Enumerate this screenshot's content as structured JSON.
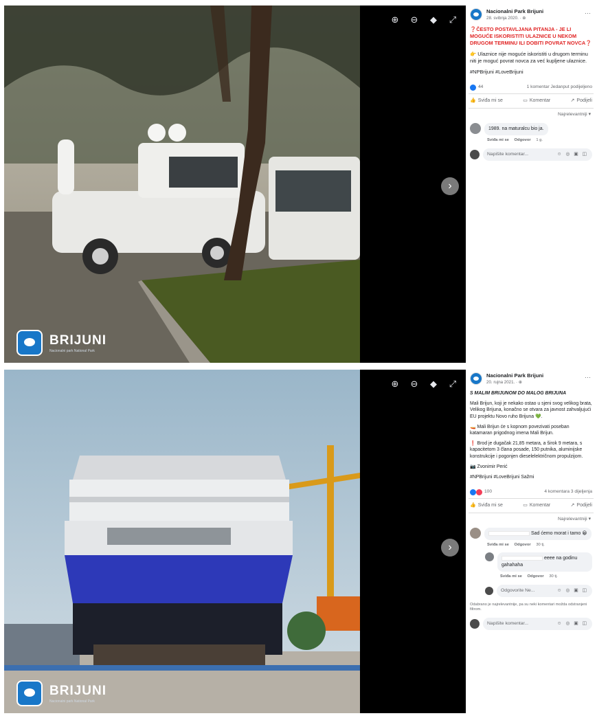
{
  "posts": [
    {
      "page_name": "Nacionalni Park Brijuni",
      "date": "28. svibnja 2020. · ⊕",
      "body": [
        "❓ČESTO POSTAVLJANA PITANJA - JE LI MOGUĆE ISKORISTITI ULAZNICE U NEKOM DRUGOM TERMINU ILI DOBITI POVRAT NOVCA❓",
        "👉 Ulaznice nije moguće iskoristiti u drugom terminu niti je moguć povrat novca za već kupljene ulaznice.",
        "#NPBrijuni #LoveBrijuni"
      ],
      "reaction_count": "44",
      "comment_share": "1 komentar Jedanput podijeljeno",
      "actions": [
        "Sviđa mi se",
        "Komentar",
        "Podijeli"
      ],
      "sort_label": "Najrelevantniji ▾",
      "comments": [
        {
          "text": "1989. na maturalcu bio ja.",
          "meta_like": "Sviđa mi se",
          "meta_reply": "Odgovor",
          "meta_time": "1 g."
        }
      ],
      "write_placeholder": "Napišite komentar...",
      "write_icons": "☺ ◎ ▣ ◫"
    },
    {
      "page_name": "Nacionalni Park Brijuni",
      "date": "20. rujna 2021. · ⊕",
      "title": "S MALIM BRIJUNOM DO MALOG BRIJUNA",
      "body": [
        "Mali Brijun, koji je nekako ostao u sjeni svog velikog brata, Velikog Brijuna, konačno se otvara za javnost zahvaljujući EU projektu Novo ruho Brijuna 💚.",
        "🚤 Mali Brijun će s kopnom povezivati poseban katamaran prigodnog imena Mali Brijun.",
        "❗ Brod je dugačak 21,85 metara, a širok 9 metara, s kapacitetom 3 člana posade, 150 putnika, aluminijske konstrukcije i pogonjen dieselelektričnom propulzijom.",
        "📷 Zvonimir Perić",
        "#NPBrijuni #LoveBrijuni Sažmi"
      ],
      "reaction_count": "100",
      "comment_share": "4 komentara 3 dijeljenja",
      "actions": [
        "Sviđa mi se",
        "Komentar",
        "Podijeli"
      ],
      "sort_label": "Najrelevantniji ▾",
      "comments": [
        {
          "text": "Sad ćemo morat i tamo 😀",
          "meta_like": "Sviđa mi se",
          "meta_reply": "Odgovor",
          "meta_time": "30 tj."
        },
        {
          "text": "eeee na godinu gahahaha",
          "meta_like": "Sviđa mi se",
          "meta_reply": "Odgovor",
          "meta_time": "30 tj."
        }
      ],
      "reply_placeholder": "Odgovorite Ne...",
      "filter_note": "Odabrano je najrelevantnije, pa su neki komentari možda odstranjeni filtrom.",
      "write_placeholder": "Napišite komentar...",
      "write_icons": "☺ ◎ ▣ ◫"
    }
  ],
  "logo": {
    "name": "BRIJUNI",
    "sub": "Nacionalni park National Park"
  },
  "icons": {
    "zoom_in": "zoom-in-icon",
    "zoom_out": "zoom-out-icon",
    "tag": "tag-icon",
    "fullscreen": "fullscreen-icon",
    "next": "chevron-right-icon"
  }
}
